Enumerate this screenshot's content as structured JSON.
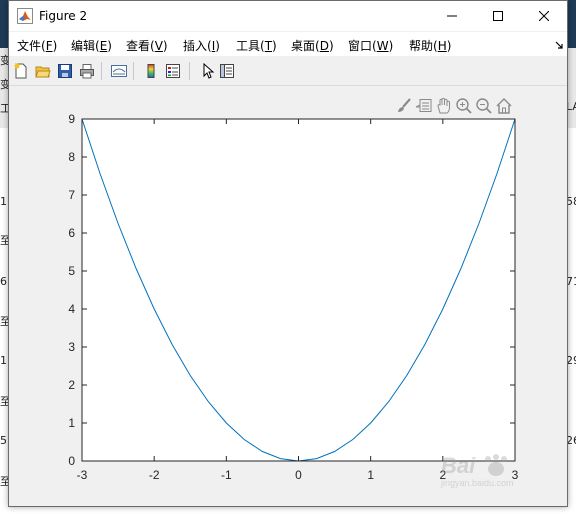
{
  "window": {
    "title": "Figure 2",
    "accent": "#0072BD"
  },
  "menu": {
    "items": [
      {
        "text": "文件(",
        "key": "F",
        "end": ")"
      },
      {
        "text": "编辑(",
        "key": "E",
        "end": ")"
      },
      {
        "text": "查看(",
        "key": "V",
        "end": ")"
      },
      {
        "text": "插入(",
        "key": "I",
        "end": ")"
      },
      {
        "text": "工具(",
        "key": "T",
        "end": ")"
      },
      {
        "text": "桌面(",
        "key": "D",
        "end": ")"
      },
      {
        "text": "窗口(",
        "key": "W",
        "end": ")"
      },
      {
        "text": "帮助(",
        "key": "H",
        "end": ")"
      }
    ]
  },
  "toolbar": {
    "icons": [
      "new-file-icon",
      "open-folder-icon",
      "save-icon",
      "print-icon",
      "link-plot-icon",
      "insert-colorbar-icon",
      "insert-legend-icon",
      "edit-plot-icon",
      "property-inspector-icon"
    ]
  },
  "axes_toolbar": {
    "icons": [
      "brush-icon",
      "data-tips-icon",
      "pan-icon",
      "zoom-in-icon",
      "zoom-out-icon",
      "restore-view-icon"
    ]
  },
  "background_fragments": [
    "变",
    "变",
    "工",
    "1",
    "至",
    "6",
    "至",
    "1",
    "至",
    "5",
    "至",
    "58",
    "71",
    "29",
    "26",
    "LA"
  ],
  "watermark": {
    "text": "Bai",
    "sub": "jingyan.baidu.com"
  },
  "chart_data": {
    "type": "line",
    "title": "",
    "xlabel": "",
    "ylabel": "",
    "xlim": [
      -3,
      3
    ],
    "ylim": [
      0,
      9
    ],
    "xticks": [
      -3,
      -2,
      -1,
      0,
      1,
      2,
      3
    ],
    "yticks": [
      0,
      1,
      2,
      3,
      4,
      5,
      6,
      7,
      8,
      9
    ],
    "xtick_labels": [
      "-3",
      "-2",
      "-1",
      "0",
      "1",
      "2",
      "3"
    ],
    "ytick_labels": [
      "0",
      "1",
      "2",
      "3",
      "4",
      "5",
      "6",
      "7",
      "8",
      "9"
    ],
    "grid": false,
    "series": [
      {
        "color": "#0072BD",
        "x": [
          -3,
          -2.75,
          -2.5,
          -2.25,
          -2,
          -1.75,
          -1.5,
          -1.25,
          -1,
          -0.75,
          -0.5,
          -0.25,
          0,
          0.25,
          0.5,
          0.75,
          1,
          1.25,
          1.5,
          1.75,
          2,
          2.25,
          2.5,
          2.75,
          3
        ],
        "y": [
          9,
          7.5625,
          6.25,
          5.0625,
          4,
          3.0625,
          2.25,
          1.5625,
          1,
          0.5625,
          0.25,
          0.0625,
          0,
          0.0625,
          0.25,
          0.5625,
          1,
          1.5625,
          2.25,
          3.0625,
          4,
          5.0625,
          6.25,
          7.5625,
          9
        ]
      }
    ]
  }
}
